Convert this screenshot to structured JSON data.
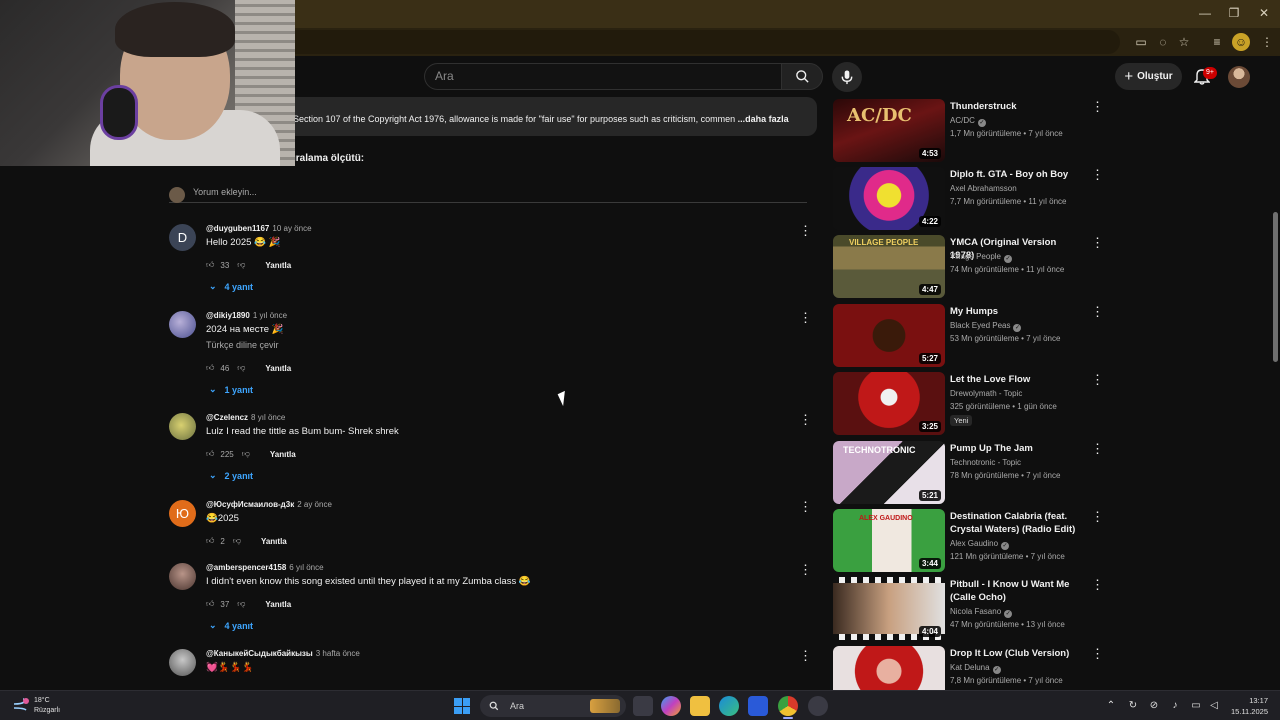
{
  "window": {
    "minimize": "—",
    "restore": "❐",
    "close": "✕"
  },
  "header": {
    "search_placeholder": "Ara",
    "create_label": "Oluştur",
    "notification_count": "9+"
  },
  "description": {
    "text": "Section 107 of the Copyright Act 1976, allowance is made for \"fair use\" for purposes such as criticism, commen",
    "more": "...daha fazla"
  },
  "comments_section": {
    "sort_label": "ıralama ölçütü:",
    "add_placeholder": "Yorum ekleyin...",
    "reply_label": "Yanıtla"
  },
  "comments": [
    {
      "avatar_letter": "D",
      "avatar_color": "#3b4456",
      "author": "@duyguben1167",
      "time": "10 ay önce",
      "text": "Hello 2025 😂 🎉",
      "likes": "33",
      "replies": "4 yanıt"
    },
    {
      "avatar_letter": "",
      "avatar_color": "#5a5fa0",
      "author": "@dikiy1890",
      "time": "1 yıl önce",
      "text": "2024 на месте 🎉",
      "translate": "Türkçe diline çevir",
      "likes": "46",
      "replies": "1 yanıt"
    },
    {
      "avatar_letter": "",
      "avatar_color": "#8a8f5a",
      "author": "@Czelencz",
      "time": "8 yıl önce",
      "text": "Lulz I read the tittle as Bum bum- Shrek shrek",
      "likes": "225",
      "replies": "2 yanıt"
    },
    {
      "avatar_letter": "Ю",
      "avatar_color": "#e06c1a",
      "author": "@ЮсуфИсмаилов-д3к",
      "time": "2 ay önce",
      "text": "😂2025",
      "likes": "2",
      "replies": ""
    },
    {
      "avatar_letter": "",
      "avatar_color": "#6a5550",
      "author": "@amberspencer4158",
      "time": "6 yıl önce",
      "text": "I didn't even know this song existed until they played it at my Zumba class 😂",
      "likes": "37",
      "replies": "4 yanıt"
    },
    {
      "avatar_letter": "",
      "avatar_color": "#6a6a6a",
      "author": "@КаныкейСыдыкбайкызы",
      "time": "3 hafta önce",
      "text": "💓💃💃💃",
      "likes": "",
      "replies": ""
    }
  ],
  "sidebar": [
    {
      "title": "Thunderstruck",
      "channel": "AC/DC",
      "verified": true,
      "meta": "1,7 Mn görüntüleme • 7 yıl önce",
      "duration": "4:53",
      "thumb_color": "#6a1414",
      "thumb_text": "AC/DC"
    },
    {
      "title": "Diplo ft. GTA - Boy oh Boy",
      "channel": "Axel Abrahamsson",
      "verified": false,
      "meta": "7,7 Mn görüntüleme • 11 yıl önce",
      "duration": "4:22",
      "thumb_color": "#c42a8a",
      "thumb_text": ""
    },
    {
      "title": "YMCA (Original Version 1978)",
      "channel": "Village People",
      "verified": true,
      "meta": "74 Mn görüntüleme • 11 yıl önce",
      "duration": "4:47",
      "thumb_color": "#6a6a3a",
      "thumb_text": "VILLAGE PEOPLE"
    },
    {
      "title": "My Humps",
      "channel": "Black Eyed Peas",
      "verified": true,
      "meta": "53 Mn görüntüleme • 7 yıl önce",
      "duration": "5:27",
      "thumb_color": "#7a1010",
      "thumb_text": ""
    },
    {
      "title": "Let the Love Flow",
      "channel": "Drewolymath - Topic",
      "verified": false,
      "meta": "325 görüntüleme • 1 gün önce",
      "badge": "Yeni",
      "duration": "3:25",
      "thumb_color": "#8a2020",
      "thumb_text": ""
    },
    {
      "title": "Pump Up The Jam",
      "channel": "Technotronic - Topic",
      "verified": false,
      "meta": "78 Mn görüntüleme • 7 yıl önce",
      "duration": "5:21",
      "thumb_color": "#a07a9a",
      "thumb_text": "TECHNOTRONIC"
    },
    {
      "title": "Destination Calabria (feat. Crystal Waters) (Radio Edit)",
      "channel": "Alex Gaudino",
      "verified": true,
      "meta": "121 Mn görüntüleme • 7 yıl önce",
      "duration": "3:44",
      "thumb_color": "#3aa040",
      "thumb_text": "ALEX GAUDINO"
    },
    {
      "title": "Pitbull - I Know U Want Me (Calle Ocho)",
      "channel": "Nicola Fasano",
      "verified": true,
      "meta": "47 Mn görüntüleme • 13 yıl önce",
      "duration": "4:04",
      "thumb_color": "#d8d8d8",
      "thumb_text": ""
    },
    {
      "title": "Drop It Low (Club Version)",
      "channel": "Kat Deluna",
      "verified": true,
      "meta": "7,8 Mn görüntüleme • 7 yıl önce",
      "duration": "",
      "thumb_color": "#b01818",
      "thumb_text": ""
    }
  ],
  "taskbar": {
    "temperature": "18°C",
    "condition": "Rüzgarlı",
    "search_label": "Ara",
    "time": "13:17",
    "date": "15.11.2025"
  }
}
